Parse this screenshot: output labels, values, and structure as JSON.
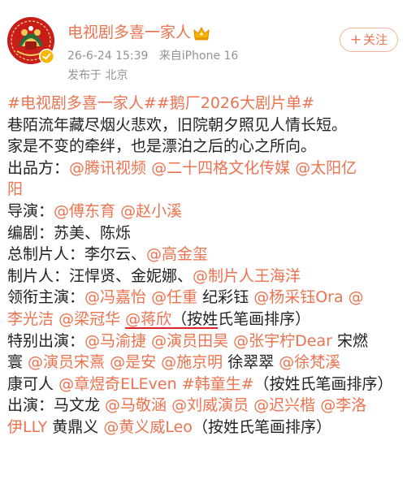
{
  "post": {
    "author": {
      "name": "电视剧多喜一家人",
      "avatar": "brand-logo",
      "verified_icon": "verified-badge-icon",
      "crown_icon": "crown-icon"
    },
    "time": "26-6-24 15:39",
    "source": "来自iPhone 16",
    "location": "发布于 北京",
    "follow_label": "关注",
    "follow_plus": "+",
    "lines": [
      [
        {
          "t": "#电视剧多喜一家人##鹅厂2026大剧片单#",
          "k": "topic"
        }
      ],
      [
        {
          "t": "巷陌流年藏尽烟火悲欢，旧院朝夕照见人情长短。",
          "k": "text"
        }
      ],
      [
        {
          "t": "家是不变的牵绊，也是漂泊之后的心之所向。",
          "k": "text"
        }
      ],
      [
        {
          "t": "出品方：",
          "k": "text"
        },
        {
          "t": "@腾讯视频",
          "k": "mention"
        },
        {
          "t": " ",
          "k": "text"
        },
        {
          "t": "@二十四格文化传媒",
          "k": "mention"
        },
        {
          "t": " ",
          "k": "text"
        },
        {
          "t": "@太阳亿",
          "k": "mention"
        }
      ],
      [
        {
          "t": "阳",
          "k": "mention"
        }
      ],
      [
        {
          "t": "导演：",
          "k": "text"
        },
        {
          "t": "@傅东育",
          "k": "mention"
        },
        {
          "t": " ",
          "k": "text"
        },
        {
          "t": "@赵小溪",
          "k": "mention"
        }
      ],
      [
        {
          "t": "编剧：苏美、陈烁",
          "k": "text"
        }
      ],
      [
        {
          "t": "总制片人：李尔云、",
          "k": "text"
        },
        {
          "t": "@高金玺",
          "k": "mention"
        }
      ],
      [
        {
          "t": "制片人：汪悍贤、金妮娜、",
          "k": "text"
        },
        {
          "t": "@制片人王海洋",
          "k": "mention"
        }
      ],
      [
        {
          "t": "领衔主演：",
          "k": "text"
        },
        {
          "t": "@冯嘉怡",
          "k": "mention"
        },
        {
          "t": " ",
          "k": "text"
        },
        {
          "t": "@任重",
          "k": "mention"
        },
        {
          "t": " 纪彩钰 ",
          "k": "text"
        },
        {
          "t": "@杨采钰Ora",
          "k": "mention"
        },
        {
          "t": " ",
          "k": "text"
        },
        {
          "t": "@",
          "k": "mention"
        }
      ],
      [
        {
          "t": "李光洁",
          "k": "mention"
        },
        {
          "t": " ",
          "k": "text"
        },
        {
          "t": "@梁冠华",
          "k": "mention"
        },
        {
          "t": " ",
          "k": "text"
        },
        {
          "t": "@蒋欣",
          "k": "mention-u"
        },
        {
          "t": "（按姓",
          "k": "text-u"
        },
        {
          "t": "氏笔画排序）",
          "k": "text"
        }
      ],
      [
        {
          "t": "特别出演：",
          "k": "text"
        },
        {
          "t": "@马渝捷",
          "k": "mention"
        },
        {
          "t": " ",
          "k": "text"
        },
        {
          "t": "@演员田昊",
          "k": "mention"
        },
        {
          "t": " ",
          "k": "text"
        },
        {
          "t": "@张宇柠Dear",
          "k": "mention"
        },
        {
          "t": " 宋燃",
          "k": "text"
        }
      ],
      [
        {
          "t": "寰 ",
          "k": "text"
        },
        {
          "t": "@演员宋熹",
          "k": "mention"
        },
        {
          "t": " ",
          "k": "text"
        },
        {
          "t": "@是安",
          "k": "mention"
        },
        {
          "t": " ",
          "k": "text"
        },
        {
          "t": "@施京明",
          "k": "mention"
        },
        {
          "t": " 徐翠翠 ",
          "k": "text"
        },
        {
          "t": "@徐梵溪",
          "k": "mention"
        }
      ],
      [
        {
          "t": "康可人",
          "k": "text"
        },
        {
          "t": " ",
          "k": "text"
        },
        {
          "t": "@章煜奇ELEven",
          "k": "mention"
        },
        {
          "t": " ",
          "k": "text"
        },
        {
          "t": "#韩童生#",
          "k": "topic"
        },
        {
          "t": "（按姓氏笔画排序）",
          "k": "text"
        }
      ],
      [
        {
          "t": "出演：马文龙 ",
          "k": "text"
        },
        {
          "t": "@马敬涵",
          "k": "mention"
        },
        {
          "t": " ",
          "k": "text"
        },
        {
          "t": "@刘威演员",
          "k": "mention"
        },
        {
          "t": " ",
          "k": "text"
        },
        {
          "t": "@迟兴楷",
          "k": "mention"
        },
        {
          "t": " ",
          "k": "text"
        },
        {
          "t": "@李洛",
          "k": "mention"
        }
      ],
      [
        {
          "t": "伊LLY",
          "k": "mention"
        },
        {
          "t": " 黄鼎义 ",
          "k": "text"
        },
        {
          "t": "@黄义威Leo",
          "k": "mention"
        },
        {
          "t": "（按姓氏笔画排序）",
          "k": "text"
        }
      ]
    ]
  },
  "colors": {
    "link": "#eb7350",
    "text": "#222222",
    "meta": "#939393",
    "underline": "#d8242a",
    "verified": "#f7b500"
  }
}
